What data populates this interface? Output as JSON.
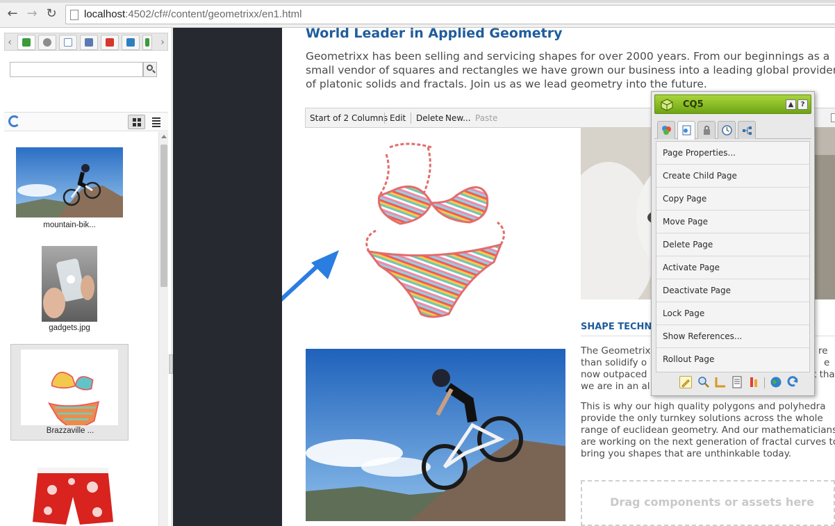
{
  "browser": {
    "url_host": "localhost",
    "url_path": ":4502/cf#/content/geometrixx/en1.html",
    "back_icon": "arrow-left-icon",
    "forward_icon": "arrow-right-icon",
    "reload_icon": "reload-icon"
  },
  "content_finder": {
    "search_placeholder": "",
    "assets": [
      {
        "caption": "mountain-bik..."
      },
      {
        "caption": "gadgets.jpg"
      },
      {
        "caption": "Brazzaville ..."
      },
      {
        "caption": ""
      }
    ]
  },
  "page": {
    "title": "World Leader in Applied Geometry",
    "intro": "Geometrixx has been selling and servicing shapes for over 2000 years. From our beginnings as a small vendor of squares and rectangles we have grown our business into a leading global provider of platonic solids and fractals. Join us as we lead geometry into the future.",
    "editbar": {
      "label": "Start of 2 Columns",
      "edit": "Edit",
      "delete": "Delete",
      "new": "New...",
      "paste": "Paste"
    },
    "section_heading": "SHAPE TECHNO",
    "para1_lines": [
      "The Geometrix",
      "than solidify o",
      "now outpaced",
      "we are in an al"
    ],
    "para1_tail": [
      "re",
      "e",
      "t tha",
      ""
    ],
    "para2": "This is why our high quality polygons and polyhedra provide the only turnkey solutions across the whole range of euclidean geometry. And our mathematicians are working on the next generation of fractal curves to bring you shapes that are unthinkable today.",
    "dropzone": "Drag components or assets here"
  },
  "sidekick": {
    "title": "CQ5",
    "collapse_btn": "▲",
    "help_btn": "?",
    "menu": [
      "Page Properties...",
      "Create Child Page",
      "Copy Page",
      "Move Page",
      "Delete Page",
      "Activate Page",
      "Deactivate Page",
      "Lock Page",
      "Show References...",
      "Rollout Page"
    ]
  },
  "colors": {
    "heading": "#1f5d9c",
    "sidekick_green": "#8cc02a",
    "splitter": "#262a30",
    "annotation_arrow": "#2a7de1"
  }
}
